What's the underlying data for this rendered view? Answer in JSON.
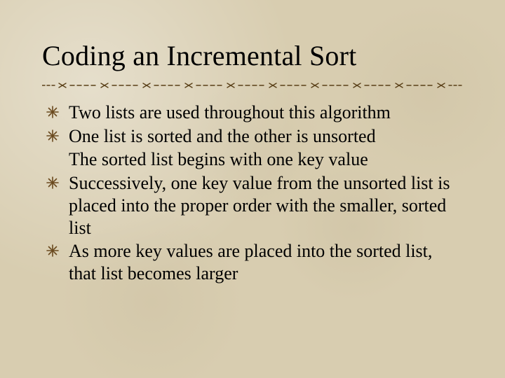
{
  "title": "Coding an Incremental Sort",
  "bullets": [
    {
      "text": "Two lists are used throughout this algorithm",
      "marker": true
    },
    {
      "text": "One list is sorted and the other is unsorted",
      "marker": true
    },
    {
      "text": " The sorted list begins with one key value",
      "marker": false
    },
    {
      "text": "Successively, one key value from the unsorted list is placed into the proper order with the smaller, sorted list",
      "marker": true
    },
    {
      "text": "As more key values are placed into the sorted list, that list becomes larger",
      "marker": true
    }
  ],
  "colors": {
    "background": "#d8cdb0",
    "text": "#000000",
    "accent": "#6b4a1f"
  }
}
